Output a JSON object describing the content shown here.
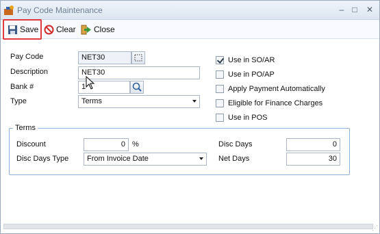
{
  "window": {
    "title": "Pay Code Maintenance",
    "controls": {
      "minimize": "–",
      "maximize": "□",
      "close": "✕"
    }
  },
  "toolbar": {
    "save_label": "Save",
    "clear_label": "Clear",
    "close_label": "Close"
  },
  "form": {
    "pay_code": {
      "label": "Pay Code",
      "value": "NET30"
    },
    "description": {
      "label": "Description",
      "value": "NET30"
    },
    "bank": {
      "label": "Bank #",
      "value": "1"
    },
    "type": {
      "label": "Type",
      "value": "Terms"
    }
  },
  "options": [
    {
      "label": "Use in SO/AR",
      "checked": true
    },
    {
      "label": "Use in PO/AP",
      "checked": false
    },
    {
      "label": "Apply Payment Automatically",
      "checked": false
    },
    {
      "label": "Eligible for Finance Charges",
      "checked": false
    },
    {
      "label": "Use in POS",
      "checked": false
    }
  ],
  "terms": {
    "group_label": "Terms",
    "discount": {
      "label": "Discount",
      "value": "0",
      "unit": "%"
    },
    "disc_days_type": {
      "label": "Disc Days Type",
      "value": "From Invoice Date"
    },
    "disc_days": {
      "label": "Disc Days",
      "value": "0"
    },
    "net_days": {
      "label": "Net Days",
      "value": "30"
    }
  },
  "colors": {
    "highlight": "#e0393b",
    "group_border": "#8fb1d8"
  }
}
